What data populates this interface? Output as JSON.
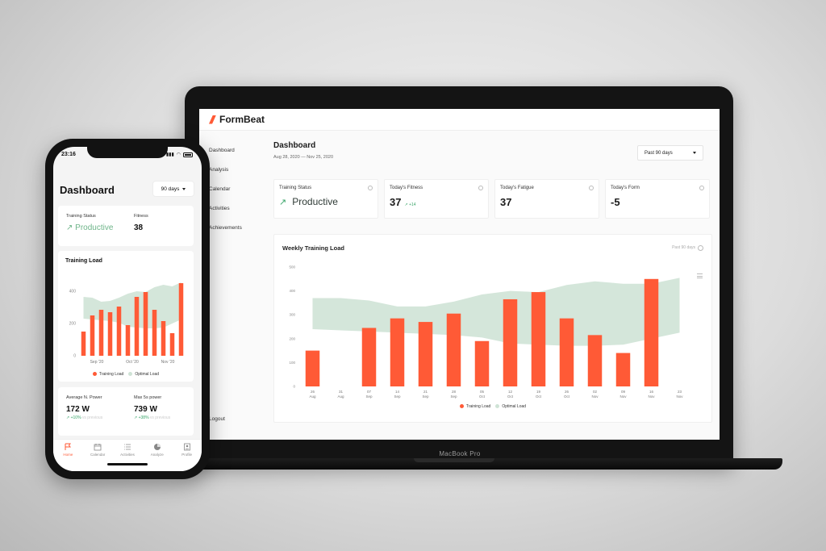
{
  "brand": {
    "name": "FormBeat",
    "accent": "#ff5a36",
    "optimal_color": "#cfe3d6"
  },
  "laptop": {
    "label": "MacBook Pro",
    "nav": [
      "Dashboard",
      "Analysis",
      "Calendar",
      "Activities",
      "Achievements"
    ],
    "logout": "Logout",
    "title": "Dashboard",
    "date_range": "Aug 28, 2020 — Nov 25, 2020",
    "period_select": "Past 90 days",
    "cards": [
      {
        "label": "Training Status",
        "value": "Productive",
        "icon": "arrow-up-right-icon"
      },
      {
        "label": "Today's Fitness",
        "value": "37",
        "delta": "+14"
      },
      {
        "label": "Today's Fatigue",
        "value": "37"
      },
      {
        "label": "Today's Form",
        "value": "-5"
      }
    ],
    "chart_title": "Weekly Training Load",
    "chart_range": "Past 90 days",
    "legend": {
      "training": "Training Load",
      "optimal": "Optimal Load"
    }
  },
  "phone": {
    "time": "23:16",
    "title": "Dashboard",
    "period_select": "90 days",
    "status_card": {
      "status_label": "Training Status",
      "status_value": "Productive",
      "fitness_label": "Fitness",
      "fitness_value": "38"
    },
    "chart_title": "Training Load",
    "legend": {
      "training": "Training Load",
      "optimal": "Optimal Load"
    },
    "power_card": {
      "avg_label": "Average N. Power",
      "avg_value": "172 W",
      "avg_delta": "+10%",
      "avg_suffix": "vs previous",
      "max_label": "Max 5s power",
      "max_value": "739 W",
      "max_delta": "+38%",
      "max_suffix": "vs previous"
    },
    "tabs": [
      {
        "label": "Home",
        "icon": "flag-icon"
      },
      {
        "label": "Calendar",
        "icon": "calendar-icon"
      },
      {
        "label": "Activities",
        "icon": "list-icon"
      },
      {
        "label": "Analyze",
        "icon": "pie-icon"
      },
      {
        "label": "Profile",
        "icon": "profile-icon"
      }
    ]
  },
  "chart_data": [
    {
      "type": "bar",
      "title": "Weekly Training Load",
      "categories": [
        "26 Aug",
        "31 Aug",
        "07 Sep",
        "14 Sep",
        "21 Sep",
        "28 Sep",
        "05 Oct",
        "12 Oct",
        "19 Oct",
        "26 Oct",
        "02 Nov",
        "09 Nov",
        "16 Nov",
        "23 Nov"
      ],
      "ylim": [
        0,
        500
      ],
      "yticks": [
        0,
        100,
        200,
        300,
        400,
        500
      ],
      "series": [
        {
          "name": "Training Load",
          "values": [
            150,
            0,
            245,
            285,
            270,
            305,
            190,
            365,
            395,
            285,
            215,
            140,
            450,
            0
          ]
        },
        {
          "name": "Optimal Load",
          "type": "area",
          "lower": [
            240,
            235,
            230,
            225,
            220,
            215,
            205,
            180,
            175,
            170,
            170,
            175,
            200,
            225
          ],
          "upper": [
            370,
            370,
            360,
            335,
            335,
            355,
            385,
            400,
            395,
            425,
            440,
            430,
            430,
            455
          ]
        }
      ]
    },
    {
      "type": "bar",
      "title": "Training Load",
      "x_tick_labels": [
        "Sep '20",
        "Oct '20",
        "Nov '20"
      ],
      "ylim": [
        0,
        500
      ],
      "yticks": [
        0,
        200,
        400
      ],
      "series": [
        {
          "name": "Training Load",
          "values": [
            150,
            250,
            285,
            270,
            305,
            190,
            365,
            395,
            285,
            215,
            140,
            450
          ]
        },
        {
          "name": "Optimal Load",
          "type": "area",
          "lower": [
            230,
            225,
            220,
            215,
            205,
            180,
            175,
            170,
            170,
            175,
            200,
            225
          ],
          "upper": [
            365,
            360,
            335,
            340,
            360,
            385,
            400,
            395,
            425,
            440,
            430,
            455
          ]
        }
      ]
    }
  ]
}
